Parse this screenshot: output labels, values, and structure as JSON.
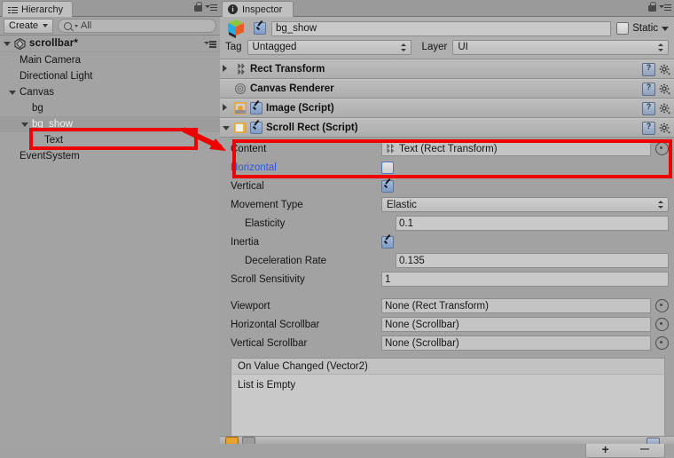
{
  "hierarchy": {
    "tab_label": "Hierarchy",
    "tab_icon": "list-icon",
    "lock_icon": "lock-icon",
    "menu_icon": "hamburger-menu-icon",
    "create_label": "Create",
    "search_placeholder": "All",
    "search_value": "All",
    "search_icon": "search-icon",
    "scene_name": "scrollbar*",
    "scene_icon": "unity-scene-icon",
    "items": [
      {
        "label": "Main Camera",
        "depth": 1,
        "fold": "none",
        "selected": false,
        "boxed": false
      },
      {
        "label": "Directional Light",
        "depth": 1,
        "fold": "none",
        "selected": false,
        "boxed": false
      },
      {
        "label": "Canvas",
        "depth": 1,
        "fold": "open",
        "selected": false,
        "boxed": false
      },
      {
        "label": "bg",
        "depth": 2,
        "fold": "none",
        "selected": false,
        "boxed": false
      },
      {
        "label": "bg_show",
        "depth": 2,
        "fold": "open",
        "selected": true,
        "boxed": false
      },
      {
        "label": "Text",
        "depth": 3,
        "fold": "none",
        "selected": false,
        "boxed": true
      },
      {
        "label": "EventSystem",
        "depth": 1,
        "fold": "none",
        "selected": false,
        "boxed": false
      }
    ]
  },
  "inspector": {
    "tab_label": "Inspector",
    "tab_icon": "info-icon",
    "lock_icon": "lock-icon",
    "menu_icon": "hamburger-menu-icon",
    "gameobject": {
      "icon": "gameobject-cube-icon",
      "enabled": true,
      "name_value": "bg_show",
      "static_label": "Static",
      "static_checked": false,
      "tag_label": "Tag",
      "tag_value": "Untagged",
      "layer_label": "Layer",
      "layer_value": "UI"
    },
    "components": [
      {
        "title": "Rect Transform",
        "icon": "rect-transform-icon",
        "fold": "closed",
        "has_toggle": false,
        "enabled": false
      },
      {
        "title": "Canvas Renderer",
        "icon": "canvas-renderer-icon",
        "fold": "none",
        "has_toggle": false,
        "enabled": false
      },
      {
        "title": "Image (Script)",
        "icon": "image-script-icon",
        "fold": "closed",
        "has_toggle": true,
        "enabled": true
      },
      {
        "title": "Scroll Rect (Script)",
        "icon": "scroll-rect-icon",
        "fold": "open",
        "has_toggle": true,
        "enabled": true
      }
    ],
    "help_icon": "help-book-icon",
    "gear_icon": "gear-icon",
    "scroll_rect": {
      "rows": [
        {
          "label": "Content",
          "kind": "object",
          "value": "Text (Rect Transform)",
          "indent": false,
          "blue": true,
          "picker": true,
          "value_icon": "rect-transform-icon"
        },
        {
          "label": "Horizontal",
          "kind": "checkbox",
          "value": false,
          "indent": false,
          "blue": true,
          "focused": true
        },
        {
          "label": "Vertical",
          "kind": "checkbox",
          "value": true,
          "indent": false,
          "blue": false
        },
        {
          "label": "Movement Type",
          "kind": "dropdown",
          "value": "Elastic",
          "indent": false,
          "blue": false
        },
        {
          "label": "Elasticity",
          "kind": "text",
          "value": "0.1",
          "indent": true,
          "blue": false
        },
        {
          "label": "Inertia",
          "kind": "checkbox",
          "value": true,
          "indent": false,
          "blue": false
        },
        {
          "label": "Deceleration Rate",
          "kind": "text",
          "value": "0.135",
          "indent": true,
          "blue": false
        },
        {
          "label": "Scroll Sensitivity",
          "kind": "text",
          "value": "1",
          "indent": false,
          "blue": false
        },
        {
          "label": "",
          "kind": "spacer",
          "value": ""
        },
        {
          "label": "Viewport",
          "kind": "object",
          "value": "None (Rect Transform)",
          "indent": false,
          "blue": false,
          "picker": true
        },
        {
          "label": "Horizontal Scrollbar",
          "kind": "object",
          "value": "None (Scrollbar)",
          "indent": false,
          "blue": false,
          "picker": true
        },
        {
          "label": "Vertical Scrollbar",
          "kind": "object",
          "value": "None (Scrollbar)",
          "indent": false,
          "blue": false,
          "picker": true
        }
      ],
      "event_header": "On Value Changed (Vector2)",
      "event_empty": "List is Empty",
      "add_label": "+",
      "remove_label": "–"
    }
  },
  "annotations": {
    "highlight_color": "#ee0000",
    "boxes": [
      {
        "name": "text-object-highlight",
        "target": "Text"
      },
      {
        "name": "scroll-rect-content-horizontal-highlight",
        "target": "Content / Horizontal"
      }
    ],
    "arrow": {
      "name": "red-arrow",
      "from": "Text",
      "to": "Content"
    }
  }
}
